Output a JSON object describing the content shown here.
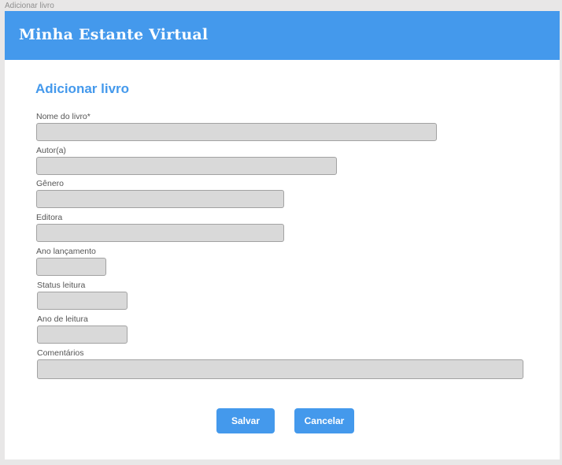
{
  "window": {
    "frame_label": "Adicionar livro"
  },
  "header": {
    "app_title": "Minha Estante Virtual",
    "bg_color": "#4499ec"
  },
  "form": {
    "title": "Adicionar livro",
    "fields": {
      "book_name": {
        "label": "Nome do livro*",
        "value": "",
        "placeholder": ""
      },
      "author": {
        "label": "Autor(a)",
        "value": "",
        "placeholder": ""
      },
      "genre": {
        "label": "Gênero",
        "value": "",
        "placeholder": ""
      },
      "publisher": {
        "label": "Editora",
        "value": "",
        "placeholder": ""
      },
      "release_year": {
        "label": "Ano lançamento",
        "value": "",
        "placeholder": ""
      },
      "reading_status": {
        "label": "Status leitura",
        "value": "",
        "placeholder": ""
      },
      "reading_year": {
        "label": "Ano de leitura",
        "value": "",
        "placeholder": ""
      },
      "comments": {
        "label": "Comentários",
        "value": "",
        "placeholder": ""
      }
    },
    "buttons": {
      "save_label": "Salvar",
      "cancel_label": "Cancelar"
    }
  },
  "colors": {
    "accent": "#4499ec",
    "input_bg": "#d9d9d9",
    "page_bg": "#e8e7e7"
  }
}
